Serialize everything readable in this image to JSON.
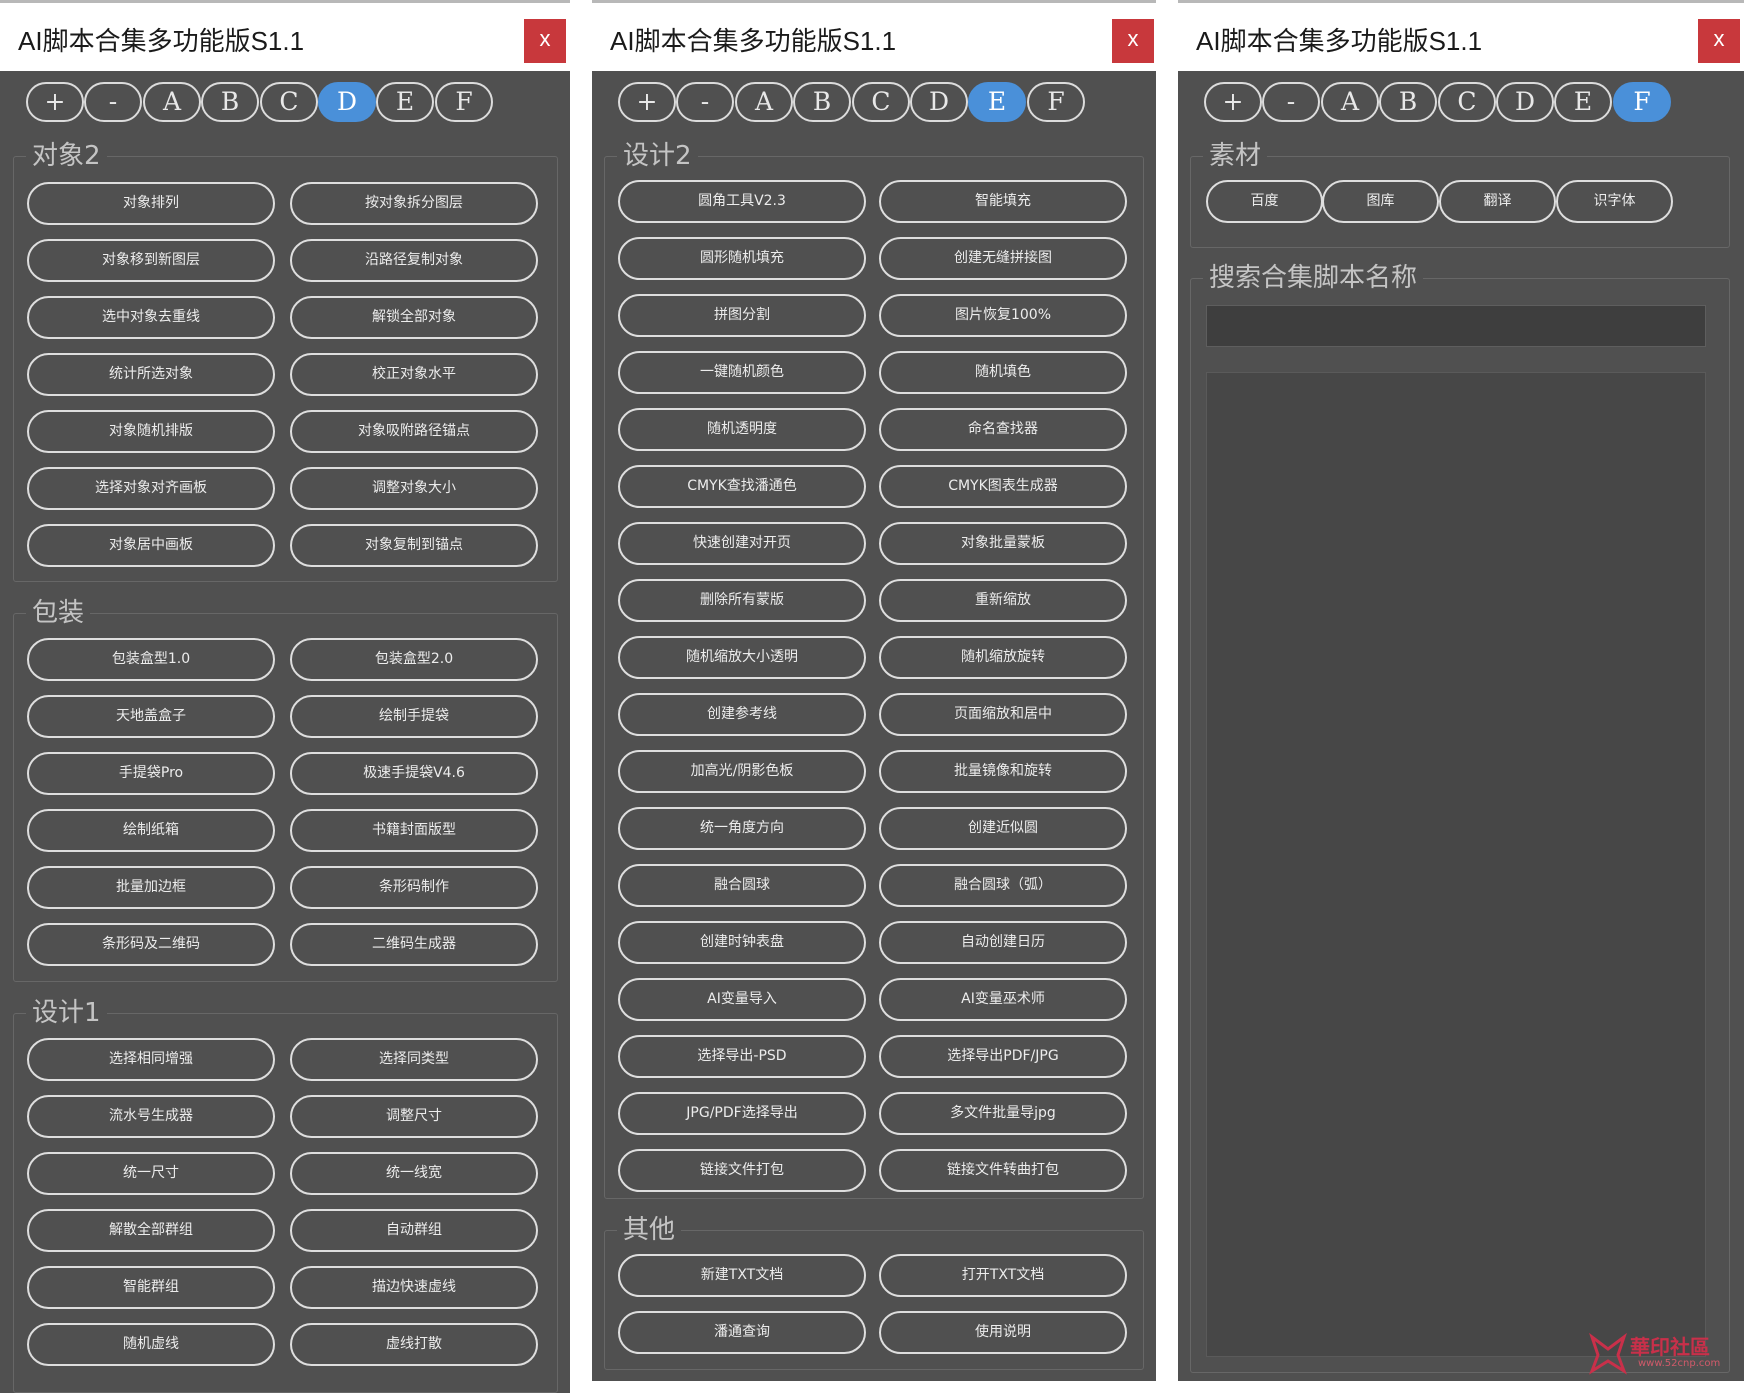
{
  "window_title": "AI脚本合集多功能版S1.1",
  "close_label": "x",
  "tabs": [
    "+",
    "-",
    "A",
    "B",
    "C",
    "D",
    "E",
    "F"
  ],
  "colors": {
    "panel_bg": "#505050",
    "active_tab": "#4a90d9",
    "close_bg": "#c8383c",
    "button_border": "#dedede"
  },
  "panels": [
    {
      "active_tab": "D",
      "groups": [
        {
          "label": "对象2",
          "buttons": [
            "对象排列",
            "按对象拆分图层",
            "对象移到新图层",
            "沿路径复制对象",
            "选中对象去重线",
            "解锁全部对象",
            "统计所选对象",
            "校正对象水平",
            "对象随机排版",
            "对象吸附路径锚点",
            "选择对象对齐画板",
            "调整对象大小",
            "对象居中画板",
            "对象复制到锚点"
          ]
        },
        {
          "label": "包装",
          "buttons": [
            "包装盒型1.0",
            "包装盒型2.0",
            "天地盖盒子",
            "绘制手提袋",
            "手提袋Pro",
            "极速手提袋V4.6",
            "绘制纸箱",
            "书籍封面版型",
            "批量加边框",
            "条形码制作",
            "条形码及二维码",
            "二维码生成器"
          ]
        },
        {
          "label": "设计1",
          "buttons": [
            "选择相同增强",
            "选择同类型",
            "流水号生成器",
            "调整尺寸",
            "统一尺寸",
            "统一线宽",
            "解散全部群组",
            "自动群组",
            "智能群组",
            "描边快速虚线",
            "随机虚线",
            "虚线打散"
          ]
        }
      ]
    },
    {
      "active_tab": "E",
      "groups": [
        {
          "label": "设计2",
          "buttons": [
            "圆角工具V2.3",
            "智能填充",
            "圆形随机填充",
            "创建无缝拼接图",
            "拼图分割",
            "图片恢复100%",
            "一键随机颜色",
            "随机填色",
            "随机透明度",
            "命名查找器",
            "CMYK查找潘通色",
            "CMYK图表生成器",
            "快速创建对开页",
            "对象批量蒙板",
            "删除所有蒙版",
            "重新缩放",
            "随机缩放大小透明",
            "随机缩放旋转",
            "创建参考线",
            "页面缩放和居中",
            "加高光/阴影色板",
            "批量镜像和旋转",
            "统一角度方向",
            "创建近似圆",
            "融合圆球",
            "融合圆球（弧）",
            "创建时钟表盘",
            "自动创建日历",
            "AI变量导入",
            "AI变量巫术师",
            "选择导出-PSD",
            "选择导出PDF/JPG",
            "JPG/PDF选择导出",
            "多文件批量导jpg",
            "链接文件打包",
            "链接文件转曲打包"
          ]
        },
        {
          "label": "其他",
          "buttons": [
            "新建TXT文档",
            "打开TXT文档",
            "潘通查询",
            "使用说明"
          ]
        }
      ]
    },
    {
      "active_tab": "F",
      "material": {
        "label": "素材",
        "buttons": [
          "百度",
          "图库",
          "翻译",
          "识字体"
        ]
      },
      "search": {
        "label": "搜索合集脚本名称",
        "value": ""
      }
    }
  ],
  "watermark": {
    "text": "華印社區",
    "url": "www.52cnp.com"
  }
}
